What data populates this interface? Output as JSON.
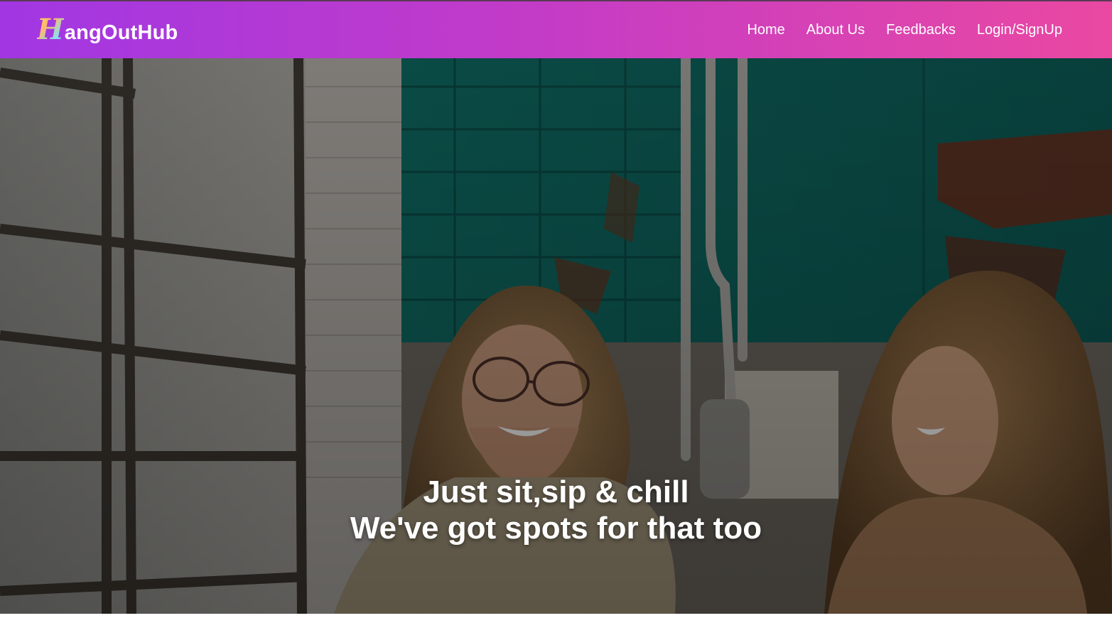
{
  "brand": {
    "initial": "H",
    "rest": "angOutHub"
  },
  "nav": {
    "items": [
      {
        "label": "Home"
      },
      {
        "label": "About Us"
      },
      {
        "label": "Feedbacks"
      },
      {
        "label": "Login/SignUp"
      }
    ]
  },
  "hero": {
    "line1": "Just sit,sip & chill",
    "line2": "We've got spots for that too"
  },
  "colors": {
    "nav_gradient_start": "#a137e3",
    "nav_gradient_end": "#ea48a2",
    "hero_text": "#ffffff"
  }
}
